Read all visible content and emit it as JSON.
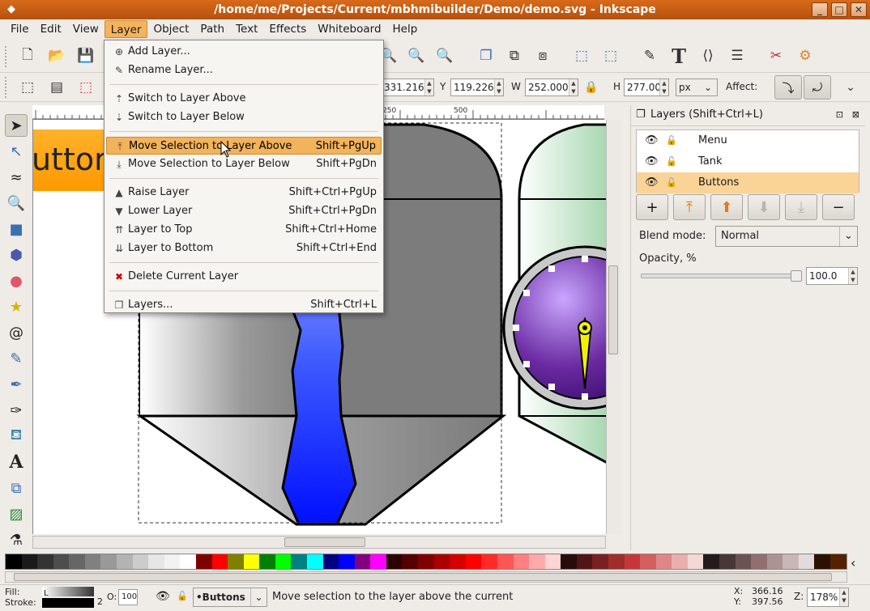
{
  "window": {
    "title": "/home/me/Projects/Current/mbhmibuilder/Demo/demo.svg - Inkscape"
  },
  "menubar": [
    "File",
    "Edit",
    "View",
    "Layer",
    "Object",
    "Path",
    "Text",
    "Effects",
    "Whiteboard",
    "Help"
  ],
  "active_menu": "Layer",
  "layer_menu": [
    {
      "label": "Add Layer...",
      "shortcut": "",
      "icon": "add-layer-icon"
    },
    {
      "label": "Rename Layer...",
      "shortcut": "",
      "icon": "rename-layer-icon"
    },
    {
      "sep": true
    },
    {
      "label": "Switch to Layer Above",
      "shortcut": "",
      "icon": "layer-above-icon"
    },
    {
      "label": "Switch to Layer Below",
      "shortcut": "",
      "icon": "layer-below-icon"
    },
    {
      "sep": true
    },
    {
      "label": "Move Selection to Layer Above",
      "shortcut": "Shift+PgUp",
      "icon": "move-up-layer-icon",
      "highlight": true
    },
    {
      "label": "Move Selection to Layer Below",
      "shortcut": "Shift+PgDn",
      "icon": "move-down-layer-icon"
    },
    {
      "sep": true
    },
    {
      "label": "Raise Layer",
      "shortcut": "Shift+Ctrl+PgUp",
      "icon": "raise-layer-icon"
    },
    {
      "label": "Lower Layer",
      "shortcut": "Shift+Ctrl+PgDn",
      "icon": "lower-layer-icon"
    },
    {
      "label": "Layer to Top",
      "shortcut": "Shift+Ctrl+Home",
      "icon": "layer-top-icon"
    },
    {
      "label": "Layer to Bottom",
      "shortcut": "Shift+Ctrl+End",
      "icon": "layer-bottom-icon"
    },
    {
      "sep": true
    },
    {
      "label": "Delete Current Layer",
      "shortcut": "",
      "icon": "delete-layer-icon"
    },
    {
      "sep": true
    },
    {
      "label": "Layers...",
      "shortcut": "Shift+Ctrl+L",
      "icon": "layers-icon"
    }
  ],
  "selectbar": {
    "y_label": "Y",
    "y_value": "119.226",
    "x_value": "331.216",
    "w_label": "W",
    "w_value": "252.000",
    "h_label": "H",
    "h_value": "277.000",
    "unit": "px",
    "affect_label": "Affect:"
  },
  "ruler": {
    "labels": [
      "250",
      "500"
    ]
  },
  "canvas": {
    "button_text": "uttor"
  },
  "layers_panel": {
    "title": "Layers (Shift+Ctrl+L)",
    "layers": [
      {
        "name": "Menu"
      },
      {
        "name": "Tank"
      },
      {
        "name": "Buttons"
      }
    ],
    "selected": "Buttons",
    "blend_label": "Blend mode:",
    "blend_value": "Normal",
    "opacity_label": "Opacity, %",
    "opacity_value": "100.0"
  },
  "palette": [
    "#000000",
    "#1a1a1a",
    "#333333",
    "#4d4d4d",
    "#666666",
    "#808080",
    "#999999",
    "#b3b3b3",
    "#cccccc",
    "#e6e6e6",
    "#f2f2f2",
    "#ffffff",
    "#800000",
    "#ff0000",
    "#808000",
    "#ffff00",
    "#008000",
    "#00ff00",
    "#008080",
    "#00ffff",
    "#000080",
    "#0000ff",
    "#800080",
    "#ff00ff",
    "#2b0000",
    "#550000",
    "#800000",
    "#aa0000",
    "#d40000",
    "#ff0000",
    "#ff2a2a",
    "#ff5555",
    "#ff8080",
    "#ffaaaa",
    "#ffd5d5",
    "#280b0b",
    "#501616",
    "#782121",
    "#a02c2c",
    "#c83737",
    "#d35f5f",
    "#de8787",
    "#e9afaf",
    "#f4d7d7",
    "#241c1c",
    "#483737",
    "#6c5353",
    "#916f6f",
    "#ac9393",
    "#c8b7b7",
    "#e3dbdb",
    "#2b1100",
    "#552200"
  ],
  "statusbar": {
    "fill_label": "Fill:",
    "stroke_label": "Stroke:",
    "fill_value": "L",
    "stroke_width": "2",
    "opacity_label": "O:",
    "opacity_value": "100",
    "layer": "•Buttons",
    "message": "Move selection to the layer above the current",
    "x_label": "X:",
    "x_value": "366.16",
    "y_label": "Y:",
    "y_value": "397.56",
    "zoom_label": "Z:",
    "zoom_value": "178%"
  }
}
